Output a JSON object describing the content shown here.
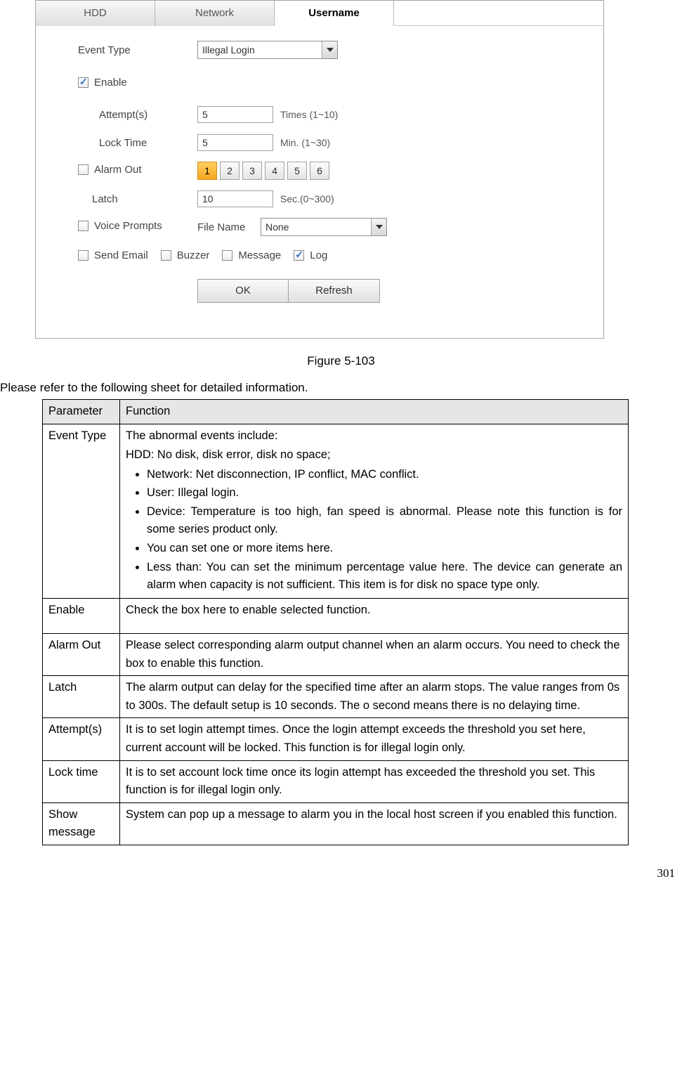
{
  "ui": {
    "tabs": [
      "HDD",
      "Network",
      "Username"
    ],
    "active_tab": 2,
    "event_type_label": "Event Type",
    "event_type_value": "Illegal Login",
    "enable_label": "Enable",
    "enable_checked": true,
    "attempts_label": "Attempt(s)",
    "attempts_value": "5",
    "attempts_hint": "Times (1~10)",
    "locktime_label": "Lock Time",
    "locktime_value": "5",
    "locktime_hint": "Min. (1~30)",
    "alarmout_label": "Alarm Out",
    "alarmout_checked": false,
    "alarm_channels": [
      "1",
      "2",
      "3",
      "4",
      "5",
      "6"
    ],
    "alarm_selected": 0,
    "latch_label": "Latch",
    "latch_value": "10",
    "latch_hint": "Sec.(0~300)",
    "voice_label": "Voice Prompts",
    "voice_checked": false,
    "filename_label": "File Name",
    "filename_value": "None",
    "sendemail_label": "Send Email",
    "sendemail_checked": false,
    "buzzer_label": "Buzzer",
    "buzzer_checked": false,
    "message_label": "Message",
    "message_checked": false,
    "log_label": "Log",
    "log_checked": true,
    "ok_btn": "OK",
    "refresh_btn": "Refresh"
  },
  "caption": "Figure 5-103",
  "table_intro": "Please refer to the following sheet for detailed information.",
  "table": {
    "header_param": "Parameter",
    "header_func": "Function",
    "rows": [
      {
        "param": "Event Type",
        "intro1": "The abnormal events include:",
        "intro2": "HDD: No disk, disk error, disk no space;",
        "bullets": [
          "Network: Net disconnection, IP conflict, MAC conflict.",
          "User: Illegal login.",
          "Device: Temperature is too high, fan speed is abnormal. Please note this function is for some series product only.",
          "You can set one or more items here.",
          "Less than: You can set the minimum percentage value here. The device can generate an alarm when capacity is not sufficient. This item is for disk no space type only."
        ]
      },
      {
        "param": "Enable",
        "text": "Check the box here to enable selected function."
      },
      {
        "param": "Alarm Out",
        "text": "Please select corresponding alarm output channel when an alarm occurs. You need to check the box to enable this function."
      },
      {
        "param": "Latch",
        "text": "The alarm output can delay for the specified time after an alarm stops. The value ranges from 0s to 300s. The default setup is 10 seconds. The o second means there is no delaying time."
      },
      {
        "param": "Attempt(s)",
        "text": "It is to set login attempt times. Once the login attempt exceeds the threshold you set here, current account will be locked. This function is for illegal login only."
      },
      {
        "param": "Lock time",
        "text": "It is to set account lock time once its login attempt has exceeded the threshold you set. This function is for illegal login only."
      },
      {
        "param": "Show message",
        "text": "System can pop up a message to alarm you in the local host screen if you enabled this function."
      }
    ]
  },
  "page_num": "301"
}
